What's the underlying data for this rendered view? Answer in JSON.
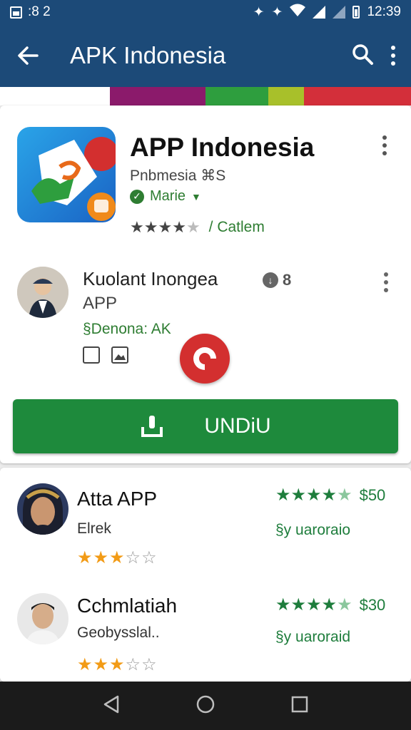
{
  "status_bar": {
    "time_left": ":8 2",
    "time_right": "12:39"
  },
  "app_bar": {
    "title": "APK Indonesia"
  },
  "banner_colors": [
    "#ffffff",
    "#8b1a6b",
    "#2e9e3e",
    "#a8c02a",
    "#d32f3a"
  ],
  "app": {
    "title": "APP Indonesia",
    "developer": "Pnbmesia ⌘S",
    "verified_label": "Marie",
    "category": "/ Catlem",
    "rating_stars": 4
  },
  "review": {
    "name": "Kuolant Inongea",
    "subtitle": "APP",
    "meta": "§Denona: AK",
    "download_count": "8"
  },
  "install_button": {
    "label": "UNDiU"
  },
  "list": [
    {
      "name": "Atta APP",
      "sub": "Elrek",
      "stars": 3,
      "rating": 4,
      "price": "$50",
      "type": "§y uaroraio"
    },
    {
      "name": "Cchmlatiah",
      "sub": "Geobysslal..",
      "stars": 3,
      "rating": 4,
      "price": "$30",
      "type": "§y uaroraid"
    }
  ],
  "colors": {
    "primary": "#1c4a78",
    "install": "#1e8a3c",
    "accent_green": "#2e7d32",
    "star_orange": "#f29b16"
  }
}
